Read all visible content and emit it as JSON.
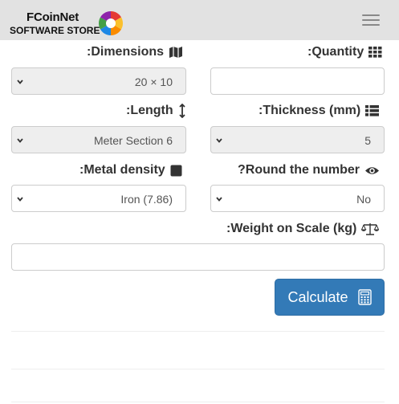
{
  "navbar": {
    "brand_line1": "FCoinNet",
    "brand_line2": "SOFTWARE STORE",
    "colors": {
      "background": "#e2e2e2",
      "menu_icon": "#888888"
    }
  },
  "form": {
    "dimensions": {
      "label": ":Dimensions",
      "icon": "map-icon",
      "value": "20 × 10"
    },
    "quantity": {
      "label": ":Quantity",
      "icon": "grid-icon",
      "value": ""
    },
    "length": {
      "label": ":Length",
      "icon": "vertical-arrows-icon",
      "value": "Meter Section 6"
    },
    "thickness": {
      "label": ":Thickness (mm)",
      "icon": "list-icon",
      "value": "5"
    },
    "metal_density": {
      "label": ":Metal density",
      "icon": "square-icon",
      "value": "Iron (7.86)"
    },
    "round_number": {
      "label": "?Round the number",
      "icon": "eye-icon",
      "value": "No"
    },
    "weight": {
      "label": ":Weight on Scale (kg)",
      "icon": "scale-icon",
      "value": ""
    }
  },
  "actions": {
    "calculate_label": "Calculate",
    "calculate_icon": "calculator-icon",
    "colors": {
      "button": "#337ab7",
      "button_text": "#ffffff"
    }
  }
}
